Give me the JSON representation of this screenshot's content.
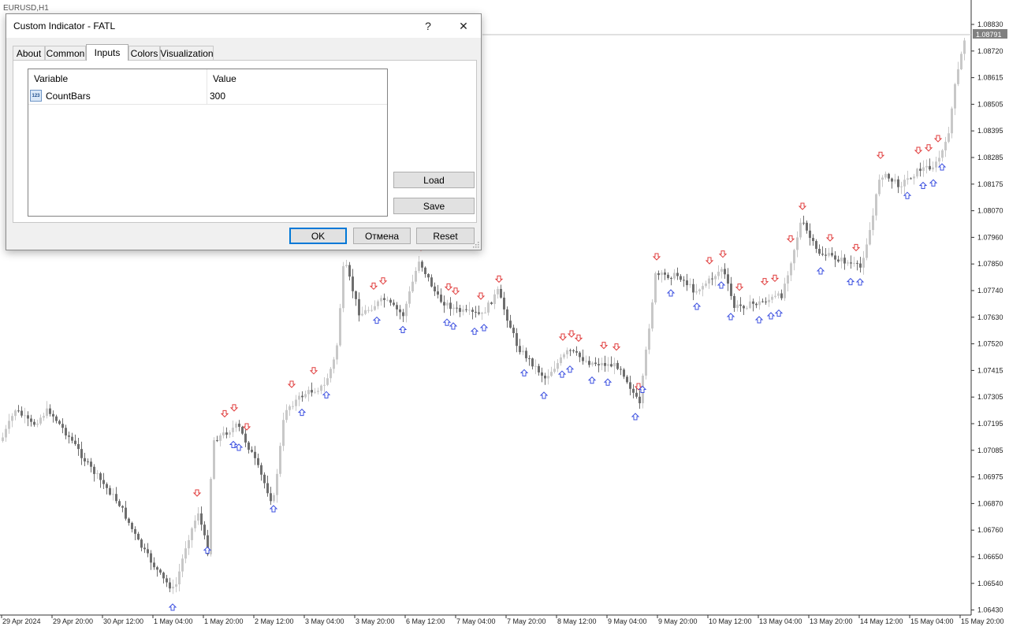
{
  "window": {
    "symbol_label": "EURUSD,H1"
  },
  "dialog": {
    "title": "Custom Indicator - FATL",
    "help": "?",
    "close": "✕",
    "tabs": [
      {
        "label": "About"
      },
      {
        "label": "Common"
      },
      {
        "label": "Inputs"
      },
      {
        "label": "Colors"
      },
      {
        "label": "Visualization"
      }
    ],
    "active_tab": "Inputs",
    "grid": {
      "col_variable": "Variable",
      "col_value": "Value",
      "rows": [
        {
          "icon_text": "123",
          "variable": "CountBars",
          "value": "300"
        }
      ]
    },
    "load": "Load",
    "save": "Save",
    "ok": "OK",
    "cancel": "Отмена",
    "reset": "Reset"
  },
  "chart": {
    "current_price": "1.08791",
    "price_labels": [
      "1.08830",
      "1.08720",
      "1.08615",
      "1.08505",
      "1.08395",
      "1.08285",
      "1.08175",
      "1.08070",
      "1.07960",
      "1.07850",
      "1.07740",
      "1.07630",
      "1.07520",
      "1.07415",
      "1.07305",
      "1.07195",
      "1.07085",
      "1.06975",
      "1.06870",
      "1.06760",
      "1.06650",
      "1.06540",
      "1.06430"
    ],
    "time_labels": [
      "29 Apr 2024",
      "29 Apr 20:00",
      "30 Apr 12:00",
      "1 May 04:00",
      "1 May 20:00",
      "2 May 12:00",
      "3 May 04:00",
      "3 May 20:00",
      "6 May 12:00",
      "7 May 04:00",
      "7 May 20:00",
      "8 May 12:00",
      "9 May 04:00",
      "9 May 20:00",
      "10 May 12:00",
      "13 May 04:00",
      "13 May 20:00",
      "14 May 12:00",
      "15 May 04:00",
      "15 May 20:00"
    ],
    "colors": {
      "bull": "#c8c8c8",
      "bear": "#6e6e6e",
      "down_arrow": "#e03c3c",
      "up_arrow": "#3c50e0"
    }
  }
}
